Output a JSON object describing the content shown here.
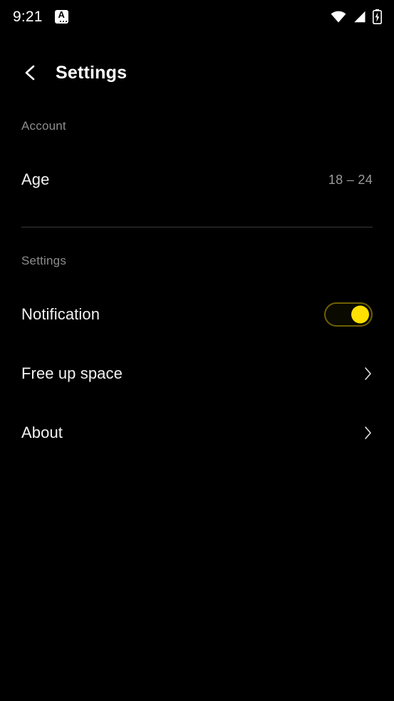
{
  "status_bar": {
    "time": "9:21",
    "badge_letter": "A",
    "icons": [
      "app-badge-icon",
      "wifi-icon",
      "cellular-signal-icon",
      "battery-charging-icon"
    ]
  },
  "header": {
    "back_icon": "chevron-left-icon",
    "title": "Settings"
  },
  "sections": [
    {
      "label": "Account",
      "rows": [
        {
          "label": "Age",
          "value": "18 – 24",
          "type": "value"
        }
      ]
    },
    {
      "label": "Settings",
      "rows": [
        {
          "label": "Notification",
          "type": "toggle",
          "toggle_on": true
        },
        {
          "label": "Free up space",
          "type": "nav",
          "chevron": "chevron-right-icon"
        },
        {
          "label": "About",
          "type": "nav",
          "chevron": "chevron-right-icon"
        }
      ]
    }
  ],
  "colors": {
    "background": "#000000",
    "accent": "#ffe000",
    "toggle_border": "#6e6000",
    "primary_text": "#f2f2f2",
    "secondary_text": "#8d8d8d",
    "divider": "#3a3a3a"
  }
}
